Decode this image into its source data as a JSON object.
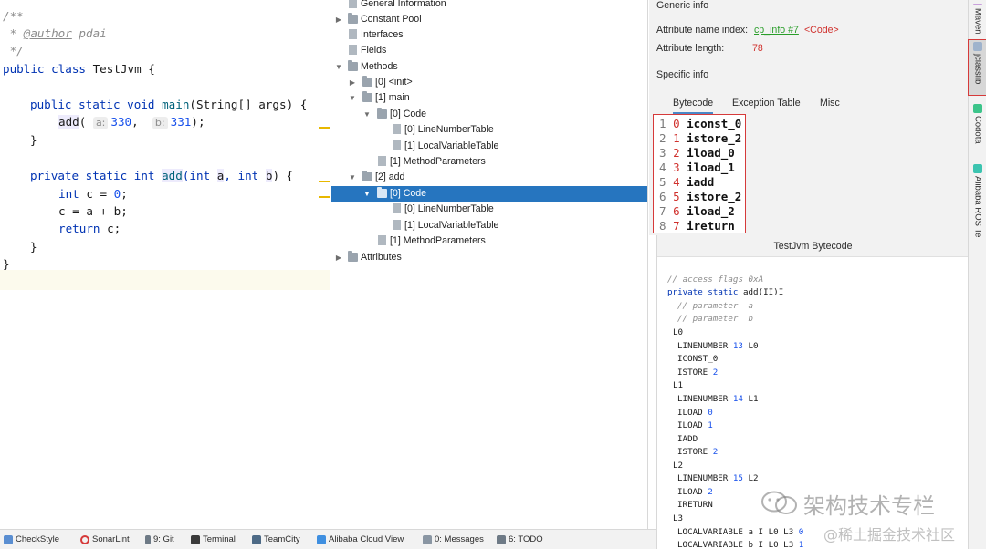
{
  "editor": {
    "line1": "/**",
    "line2_prefix": " * ",
    "line2_tag": "@author",
    "line2_rest": " pdai",
    "line3": " */",
    "class_kw": "public class",
    "class_name": " TestJvm {",
    "main_kw": "public static void",
    "main_name": "main",
    "main_rest": "(String[] args) {",
    "call_name": "add",
    "call_open": "(",
    "hint_a": "a:",
    "arg_a": "330",
    "comma": ", ",
    "hint_b": "b:",
    "arg_b": "331",
    "call_close": ");",
    "close1": "}",
    "add_kw1": "private static int",
    "add_name": "add",
    "add_p1": "(int ",
    "add_a": "a",
    "add_p2": ", int ",
    "add_b": "b",
    "add_p3": ") {",
    "int_kw": "int",
    "decl_c": " c = ",
    "zero": "0",
    "semi": ";",
    "assign": "c = a + b;",
    "return_kw": "return",
    "return_rest": " c;",
    "close2": "}",
    "close3": "}"
  },
  "tree": {
    "items": [
      {
        "label": "General Information"
      },
      {
        "label": "Constant Pool"
      },
      {
        "label": "Interfaces"
      },
      {
        "label": "Fields"
      },
      {
        "label": "Methods"
      },
      {
        "label": "[0] <init>"
      },
      {
        "label": "[1] main"
      },
      {
        "label": "[0] Code"
      },
      {
        "label": "[0] LineNumberTable"
      },
      {
        "label": "[1] LocalVariableTable"
      },
      {
        "label": "[1] MethodParameters"
      },
      {
        "label": "[2] add"
      },
      {
        "label": "[0] Code"
      },
      {
        "label": "[0] LineNumberTable"
      },
      {
        "label": "[1] LocalVariableTable"
      },
      {
        "label": "[1] MethodParameters"
      },
      {
        "label": "Attributes"
      }
    ]
  },
  "info": {
    "generic_title": "Generic info",
    "attr_name_label": "Attribute name index:",
    "attr_name_link": "cp_info #7",
    "attr_name_value": "<Code>",
    "attr_len_label": "Attribute length:",
    "attr_len_value": "78",
    "specific_title": "Specific info",
    "tabs": [
      "Bytecode",
      "Exception Table",
      "Misc"
    ],
    "bytecode": [
      {
        "ln": "1",
        "idx": "0",
        "op": "iconst_0"
      },
      {
        "ln": "2",
        "idx": "1",
        "op": "istore_2"
      },
      {
        "ln": "3",
        "idx": "2",
        "op": "iload_0"
      },
      {
        "ln": "4",
        "idx": "3",
        "op": "iload_1"
      },
      {
        "ln": "5",
        "idx": "4",
        "op": "iadd"
      },
      {
        "ln": "6",
        "idx": "5",
        "op": "istore_2"
      },
      {
        "ln": "7",
        "idx": "6",
        "op": "iload_2"
      },
      {
        "ln": "8",
        "idx": "7",
        "op": "ireturn"
      }
    ]
  },
  "bytecode_view": {
    "title": "TestJvm Bytecode",
    "l1": "// access flags 0xA",
    "l2_kw": "private static",
    "l2_rest": " add(II)I",
    "l3": "// parameter  a",
    "l4": "// parameter  b",
    "l5": "L0",
    "l6_a": "LINENUMBER ",
    "l6_n": "13",
    "l6_b": " L0",
    "l7": "ICONST_0",
    "l8_a": "ISTORE ",
    "l8_n": "2",
    "l9": "L1",
    "l10_a": "LINENUMBER ",
    "l10_n": "14",
    "l10_b": " L1",
    "l11_a": "ILOAD ",
    "l11_n": "0",
    "l12_a": "ILOAD ",
    "l12_n": "1",
    "l13": "IADD",
    "l14_a": "ISTORE ",
    "l14_n": "2",
    "l15": "L2",
    "l16_a": "LINENUMBER ",
    "l16_n": "15",
    "l16_b": " L2",
    "l17_a": "ILOAD ",
    "l17_n": "2",
    "l18": "IRETURN",
    "l19": "L3",
    "l20_a": "LOCALVARIABLE a I L0 L3 ",
    "l20_n": "0",
    "l21_a": "LOCALVARIABLE b I L0 L3 ",
    "l21_n": "1"
  },
  "right_bar": {
    "tabs": [
      "Maven",
      "jclasslib",
      "Codota",
      "Alibaba ROS Te"
    ]
  },
  "status_bar": {
    "items": [
      "CheckStyle",
      "SonarLint",
      "9: Git",
      "Terminal",
      "TeamCity",
      "Alibaba Cloud View",
      "0: Messages",
      "6: TODO"
    ]
  },
  "watermark": {
    "line1": "架构技术专栏",
    "line2": "@稀土掘金技术社区"
  },
  "colors": {
    "selection": "#2675bf",
    "highlight_border": "#d63a3a",
    "keyword": "#0033b3",
    "number": "#1750eb"
  }
}
